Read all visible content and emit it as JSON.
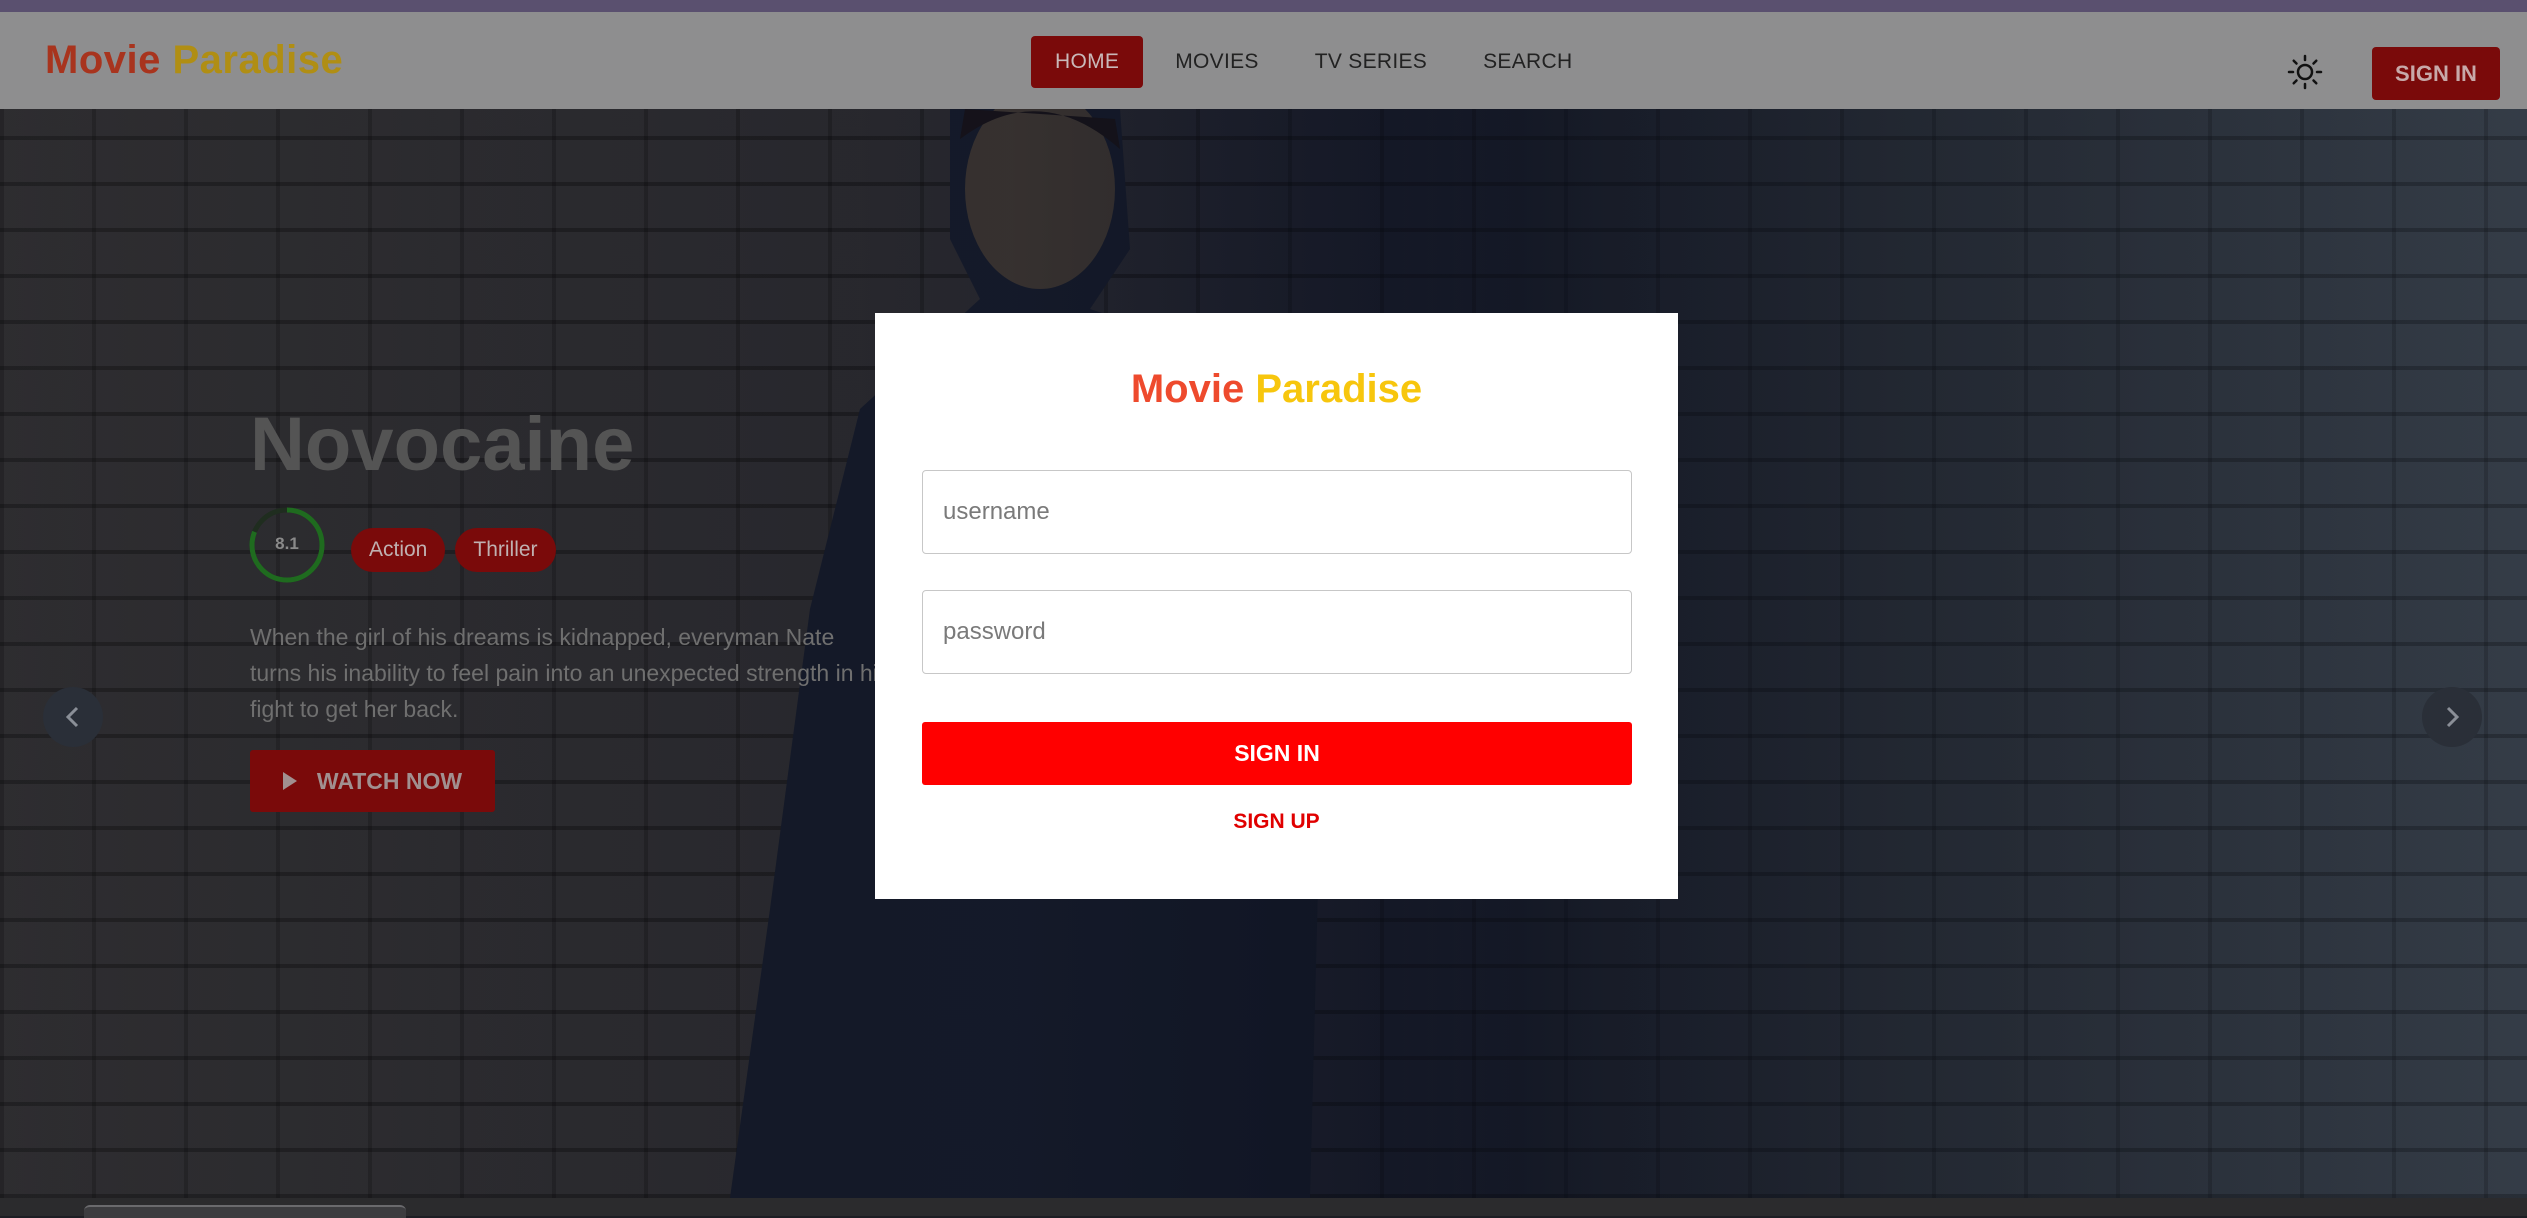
{
  "app": {
    "logo_word1": "Movie",
    "logo_word2": "Paradise"
  },
  "nav": {
    "items": [
      {
        "label": "HOME",
        "active": true
      },
      {
        "label": "MOVIES"
      },
      {
        "label": "TV SERIES"
      },
      {
        "label": "SEARCH"
      }
    ],
    "theme_icon": "sun-icon",
    "signin_label": "SIGN IN"
  },
  "hero": {
    "title": "Novocaine",
    "rating": "8.1",
    "rating_fraction": 0.81,
    "genres": [
      "Action",
      "Thriller"
    ],
    "overview": "When the girl of his dreams is kidnapped, everyman Nate turns his inability to feel pain into an unexpected strength in his fight to get her back.",
    "watch_label": "WATCH NOW",
    "prev_icon": "chevron-left-icon",
    "next_icon": "chevron-right-icon"
  },
  "modal": {
    "logo_word1": "Movie",
    "logo_word2": "Paradise",
    "username_placeholder": "username",
    "password_placeholder": "password",
    "signin_label": "SIGN IN",
    "signup_label": "SIGN UP"
  },
  "colors": {
    "accent_red": "#ff0000",
    "logo_orange": "#ee4a2d",
    "logo_yellow": "#f7c60d",
    "rating_green": "#2ecc40"
  }
}
